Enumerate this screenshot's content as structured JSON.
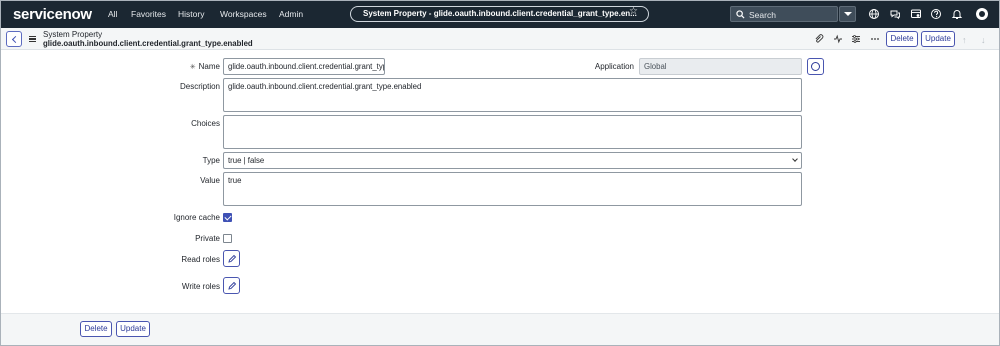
{
  "topnav": {
    "logo": "servicenow",
    "menu": [
      "All",
      "Favorites",
      "History",
      "Workspaces",
      "Admin"
    ],
    "record_title": "System Property - glide.oauth.inbound.client.credential_grant_type.en...",
    "search_placeholder": "Search"
  },
  "header": {
    "title": "System Property",
    "subtitle": "glide.oauth.inbound.client.credential.grant_type.enabled",
    "delete_label": "Delete",
    "update_label": "Update"
  },
  "form": {
    "name_label": "Name",
    "name_required_marker": "✳",
    "name_value": "glide.oauth.inbound.client.credential.grant_type.e",
    "application_label": "Application",
    "application_value": "Global",
    "description_label": "Description",
    "description_value": "glide.oauth.inbound.client.credential.grant_type.enabled",
    "choices_label": "Choices",
    "choices_value": "",
    "type_label": "Type",
    "type_value": "true | false",
    "value_label": "Value",
    "value_value": "true",
    "ignore_cache_label": "Ignore cache",
    "ignore_cache_checked": true,
    "private_label": "Private",
    "private_checked": false,
    "read_roles_label": "Read roles",
    "write_roles_label": "Write roles"
  },
  "footer": {
    "delete_label": "Delete",
    "update_label": "Update"
  },
  "colors": {
    "nav_bg": "#1b2732",
    "accent": "#3f51b5",
    "button_border": "#4a56b0"
  }
}
